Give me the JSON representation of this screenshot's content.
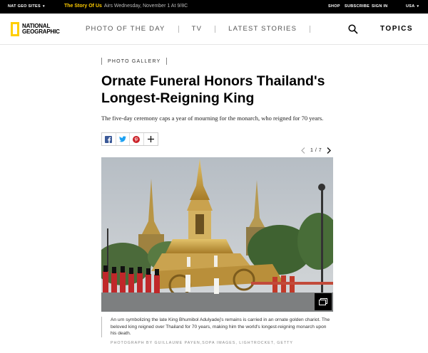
{
  "topbar": {
    "sites_label": "NAT GEO SITES",
    "promo_highlight": "The Story Of Us",
    "promo_rest": "Airs Wednesday, November 1 At 9/8C",
    "shop": "SHOP",
    "subscribe": "SUBSCRIBE",
    "signin": "SIGN IN",
    "region": "USA"
  },
  "logo": {
    "line1": "NATIONAL",
    "line2": "GEOGRAPHIC"
  },
  "nav": {
    "links": [
      "PHOTO OF THE DAY",
      "TV",
      "LATEST STORIES"
    ],
    "topics": "TOPICS"
  },
  "article": {
    "kicker": "PHOTO GALLERY",
    "headline": "Ornate Funeral Honors Thailand's Longest-Reigning King",
    "dek": "The five-day ceremony caps a year of mourning for the monarch, who reigned for 70 years.",
    "gallery": {
      "current": "1",
      "separator": "/",
      "total": "7"
    },
    "caption": "An urn symbolizing the late King Bhumibol Adulyadej's remains is carried in an ornate golden chariot. The beloved king reigned over Thailand for 70 years, making him the world's longest-reigning monarch upon his death.",
    "credit": "PHOTOGRAPH BY GUILLAUME PAYEN,SOPA IMAGES, LIGHTROCKET, GETTY"
  },
  "share_icons": [
    "facebook-icon",
    "twitter-icon",
    "pinterest-icon",
    "plus-icon"
  ],
  "colors": {
    "brand_yellow": "#ffce00",
    "promo_yellow": "#ffcc00",
    "facebook": "#3b5998",
    "twitter": "#1da1f2",
    "pinterest": "#cb2027"
  }
}
